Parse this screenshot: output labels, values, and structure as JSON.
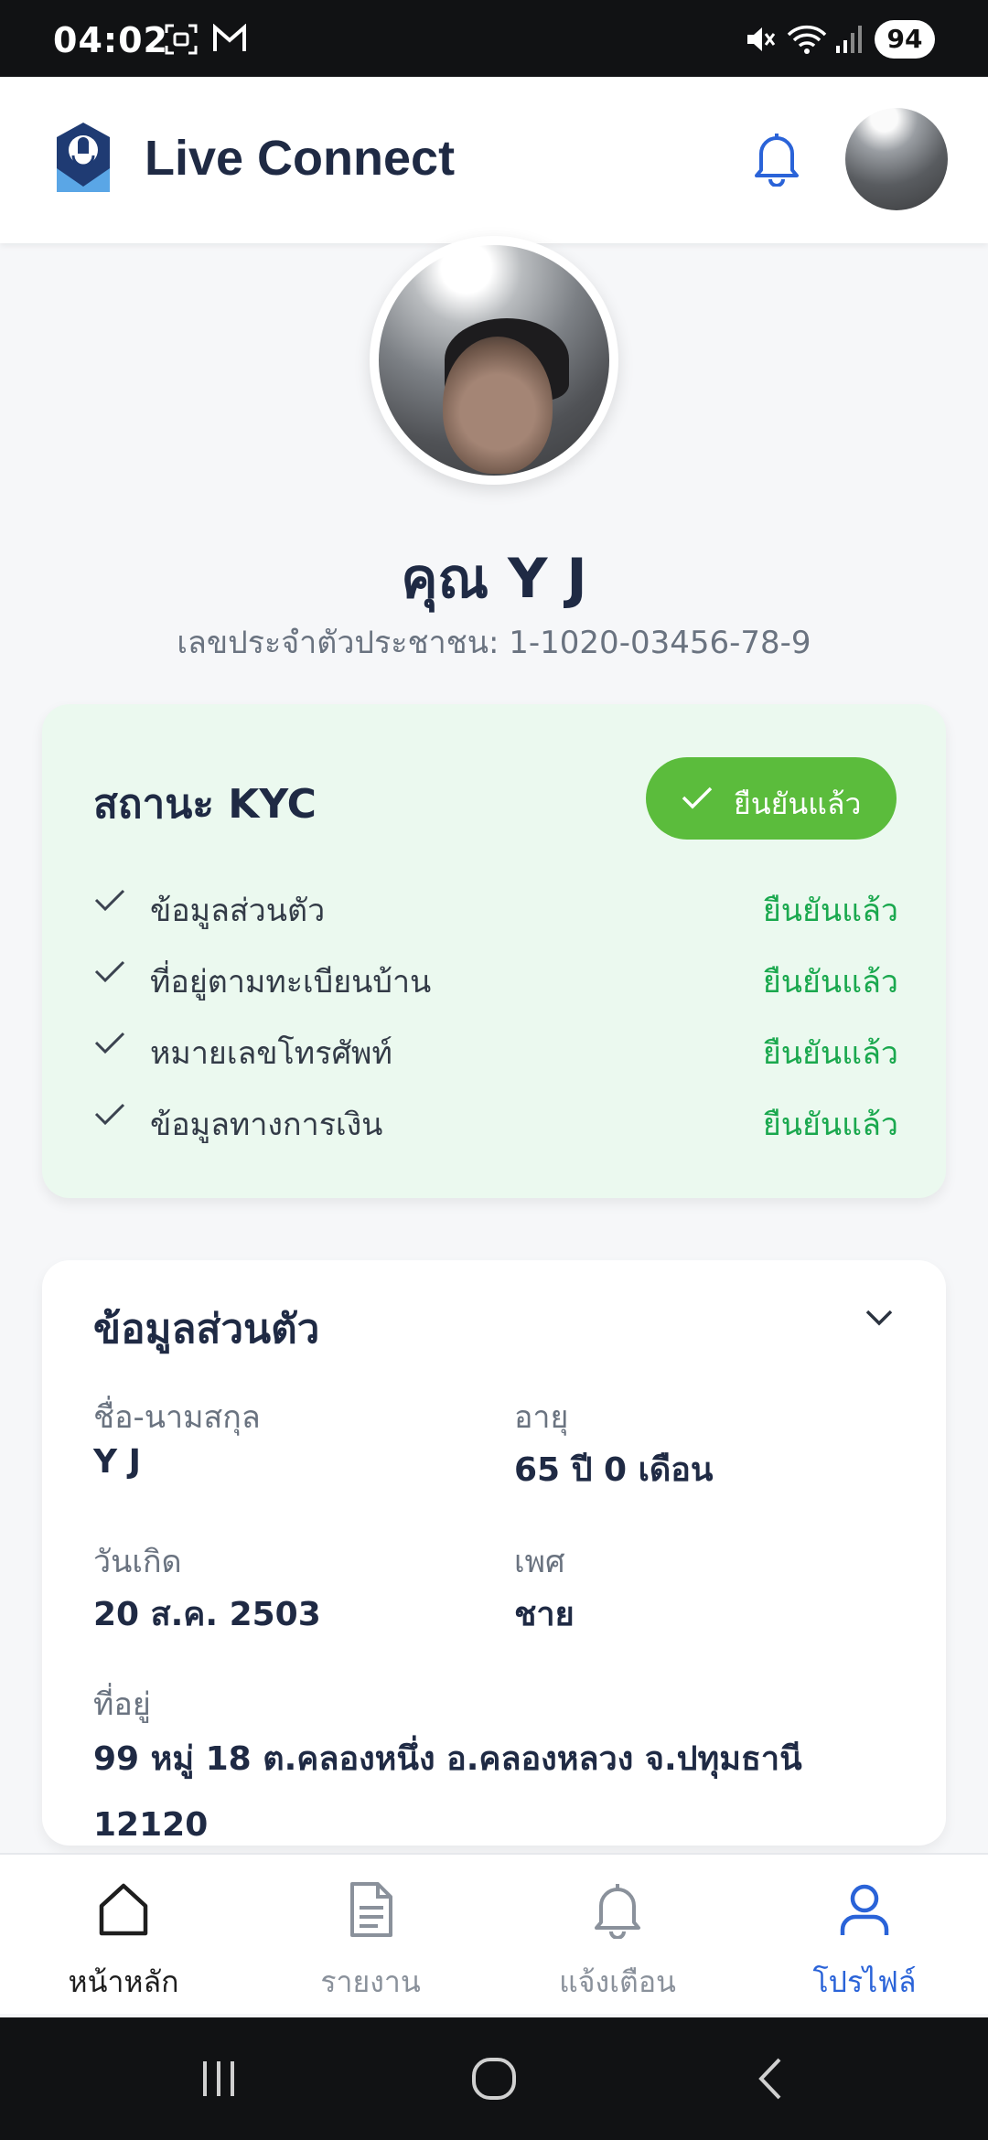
{
  "status_bar": {
    "time": "04:02",
    "battery": "94"
  },
  "app": {
    "title": "Live Connect"
  },
  "profile": {
    "name": "คุณ Y J",
    "id_label": "เลขประจำตัวประชาชน: 1-1020-03456-78-9"
  },
  "kyc": {
    "title": "สถานะ KYC",
    "badge": "ยืนยันแล้ว",
    "items": [
      {
        "label": "ข้อมูลส่วนตัว",
        "status": "ยืนยันแล้ว"
      },
      {
        "label": "ที่อยู่ตามทะเบียนบ้าน",
        "status": "ยืนยันแล้ว"
      },
      {
        "label": "หมายเลขโทรศัพท์",
        "status": "ยืนยันแล้ว"
      },
      {
        "label": "ข้อมูลทางการเงิน",
        "status": "ยืนยันแล้ว"
      }
    ]
  },
  "personal": {
    "title": "ข้อมูลส่วนตัว",
    "name_label": "ชื่อ-นามสกุล",
    "name_value": "Y J",
    "age_label": "อายุ",
    "age_value": "65 ปี 0 เดือน",
    "dob_label": "วันเกิด",
    "dob_value": "20 ส.ค. 2503",
    "gender_label": "เพศ",
    "gender_value": "ชาย",
    "address_label": "ที่อยู่",
    "address_value": "99 หมู่ 18 ต.คลองหนึ่ง อ.คลองหลวง จ.ปทุมธานี 12120"
  },
  "nav": {
    "home": "หน้าหลัก",
    "reports": "รายงาน",
    "alerts": "แจ้งเตือน",
    "profile": "โปรไฟล์"
  },
  "colors": {
    "primary": "#2a63d8",
    "success": "#1aa84e",
    "badge": "#5bbc3c",
    "kyc_bg": "#ebf9ef"
  },
  "icons": [
    "qr-scan-icon",
    "gmail-icon",
    "mute-icon",
    "wifi-icon",
    "signal-icon",
    "bell-icon",
    "chevron-down-icon",
    "check-icon",
    "home-icon",
    "document-icon",
    "user-icon"
  ]
}
